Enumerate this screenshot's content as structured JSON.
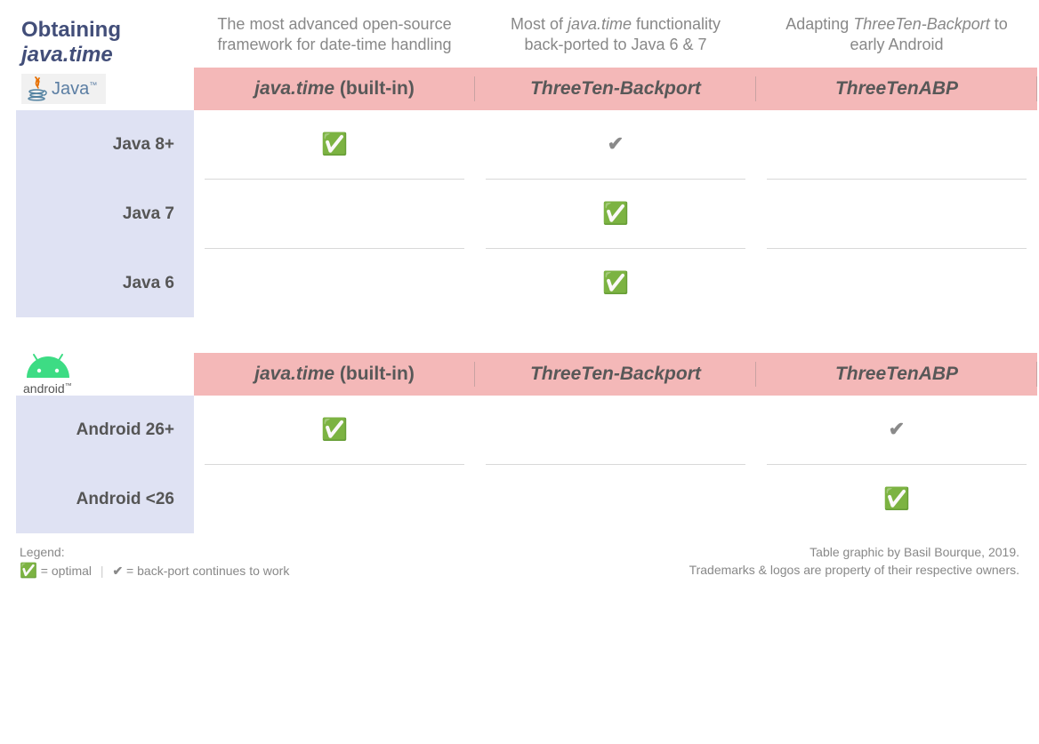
{
  "title": {
    "line1": "Obtaining",
    "line2": "java.time"
  },
  "columns": {
    "col1": {
      "desc": "The most advanced open-source framework for date-time handling",
      "header_italic": "java.time",
      "header_plain": " (built-in)"
    },
    "col2": {
      "desc_pre": "Most of ",
      "desc_it": "java.time",
      "desc_post": " functionality back-ported to Java 6 & 7",
      "header": "ThreeTen-Backport"
    },
    "col3": {
      "desc_pre": "Adapting ",
      "desc_it": "ThreeTen-Backport",
      "desc_post": " to early Android",
      "header": "ThreeTenABP"
    }
  },
  "sections": {
    "java": {
      "logo_text": "Java",
      "rows": {
        "r1": {
          "label": "Java 8+",
          "c1": "✅",
          "c2": "✔",
          "c3": ""
        },
        "r2": {
          "label": "Java 7",
          "c1": "",
          "c2": "✅",
          "c3": ""
        },
        "r3": {
          "label": "Java 6",
          "c1": "",
          "c2": "✅",
          "c3": ""
        }
      }
    },
    "android": {
      "logo_text": "android",
      "rows": {
        "r1": {
          "label": "Android 26+",
          "c1": "✅",
          "c2": "",
          "c3": "✔"
        },
        "r2": {
          "label": "Android <26",
          "c1": "",
          "c2": "",
          "c3": "✅"
        }
      }
    }
  },
  "legend": {
    "title": "Legend:",
    "optimal_symbol": "✅",
    "optimal_text": " = optimal",
    "backport_symbol": "✔",
    "backport_text": " = back-port continues to work"
  },
  "credits": {
    "line1": "Table graphic by Basil Bourque, 2019.",
    "line2": "Trademarks & logos are property of their respective owners."
  },
  "chart_data": {
    "type": "table",
    "title": "Obtaining java.time",
    "columns": [
      "java.time (built-in)",
      "ThreeTen-Backport",
      "ThreeTenABP"
    ],
    "column_descriptions": [
      "The most advanced open-source framework for date-time handling",
      "Most of java.time functionality back-ported to Java 6 & 7",
      "Adapting ThreeTen-Backport to early Android"
    ],
    "sections": [
      {
        "platform": "Java",
        "rows": [
          {
            "label": "Java 8+",
            "values": [
              "optimal",
              "backport_works",
              ""
            ]
          },
          {
            "label": "Java 7",
            "values": [
              "",
              "optimal",
              ""
            ]
          },
          {
            "label": "Java 6",
            "values": [
              "",
              "optimal",
              ""
            ]
          }
        ]
      },
      {
        "platform": "Android",
        "rows": [
          {
            "label": "Android 26+",
            "values": [
              "optimal",
              "",
              "backport_works"
            ]
          },
          {
            "label": "Android <26",
            "values": [
              "",
              "",
              "optimal"
            ]
          }
        ]
      }
    ],
    "legend": {
      "optimal": "✅ = optimal",
      "backport_works": "✔ = back-port continues to work"
    }
  }
}
